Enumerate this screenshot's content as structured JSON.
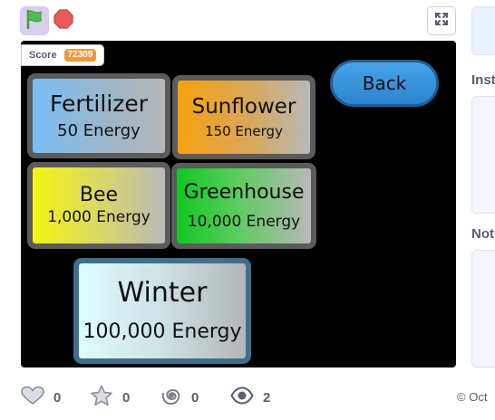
{
  "controls": {
    "flag_icon": "green-flag-icon",
    "stop_icon": "stop-icon",
    "fullscreen_icon": "fullscreen-icon"
  },
  "stage": {
    "score": {
      "label": "Score",
      "value": "72309"
    },
    "back_label": "Back",
    "tiles": {
      "fertilizer": {
        "name": "Fertilizer",
        "cost": "50 Energy"
      },
      "sunflower": {
        "name": "Sunflower",
        "cost": "150 Energy"
      },
      "bee": {
        "name": "Bee",
        "cost": "1,000 Energy"
      },
      "greenhouse": {
        "name": "Greenhouse",
        "cost": "10,000 Energy"
      },
      "winter": {
        "name": "Winter",
        "cost": "100,000 Energy"
      }
    }
  },
  "sidebar": {
    "instructions_label": "Inst",
    "notes_label": "Not"
  },
  "stats": {
    "loves": "0",
    "favorites": "0",
    "remixes": "0",
    "views": "2"
  },
  "shared_date": "Oct",
  "colors": {
    "flag_bg": "#d9cdf0",
    "stage_bg": "#000000",
    "score_badge": "#f29937",
    "back_button": "#2b84ce",
    "stat_text": "#575e75"
  }
}
